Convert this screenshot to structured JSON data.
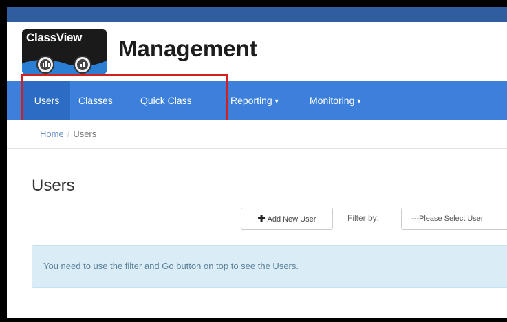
{
  "header": {
    "logo_text": "ClassView",
    "title": "Management"
  },
  "nav": {
    "items": [
      {
        "label": "Users",
        "active": true,
        "dropdown": false
      },
      {
        "label": "Classes",
        "active": false,
        "dropdown": false
      },
      {
        "label": "Quick Class",
        "active": false,
        "dropdown": false
      },
      {
        "label": "Reporting",
        "active": false,
        "dropdown": true
      },
      {
        "label": "Monitoring",
        "active": false,
        "dropdown": true
      }
    ]
  },
  "breadcrumb": {
    "home": "Home",
    "separator": "/",
    "current": "Users"
  },
  "page": {
    "title": "Users"
  },
  "toolbar": {
    "add_button_label": "Add New User",
    "add_icon": "plus-icon",
    "filter_label": "Filter by:",
    "select_value": "---Please Select User"
  },
  "alert": {
    "message": "You need to use the filter and Go button on top to see the Users."
  },
  "colors": {
    "top_bar": "#2f5d9e",
    "nav_bar": "#3c80dc",
    "nav_active": "#2d6cc4",
    "highlight": "#d02020",
    "alert_bg": "#daedf7"
  }
}
